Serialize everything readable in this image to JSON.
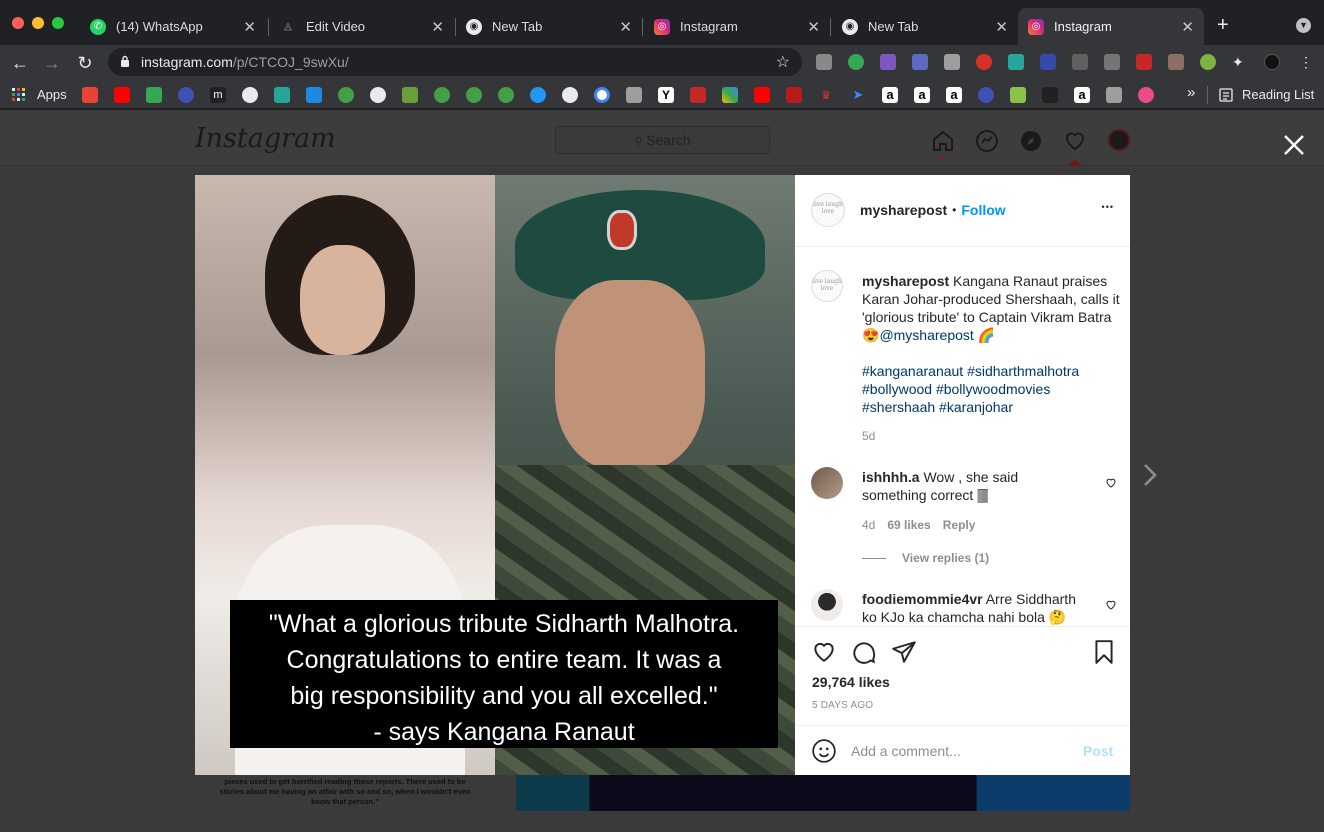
{
  "browser": {
    "tabs": [
      {
        "title": "(14) WhatsApp",
        "icon": "whatsapp-icon",
        "color": "#25d366"
      },
      {
        "title": "Edit Video",
        "icon": "edit-video-icon",
        "color": "#5f6368"
      },
      {
        "title": "New Tab",
        "icon": "chrome-icon",
        "color": "#e8eaed"
      },
      {
        "title": "Instagram",
        "icon": "instagram-icon",
        "color": "#e1306c"
      },
      {
        "title": "New Tab",
        "icon": "chrome-icon",
        "color": "#e8eaed"
      },
      {
        "title": "Instagram",
        "icon": "instagram-icon",
        "color": "#e1306c"
      }
    ],
    "url_host": "instagram.com",
    "url_path": "/p/CTCOJ_9swXu/",
    "bookmarks": {
      "apps_label": "Apps",
      "reading_list_label": "Reading List",
      "overflow_label": "»"
    }
  },
  "instagram": {
    "logo": "Instagram",
    "search_placeholder": "Search",
    "accent": "#0095f6"
  },
  "post": {
    "image_caption_lines": [
      "\"What a glorious tribute Sidharth Malhotra.",
      "Congratulations to entire team. It was a",
      "big responsibility and you all excelled.\"",
      "- says Kangana Ranaut"
    ],
    "below_image_text": [
      "pieces used to get horrified reading those reports. There used to be",
      "stories about me having an affair with so and so, when I wouldn't even",
      "know that person.\""
    ],
    "author": "mysharepost",
    "follow_separator": "•",
    "follow_label": "Follow",
    "more_label": "•••",
    "avatar_text": "live laugh love",
    "caption_text": "Kangana Ranaut praises Karan Johar-produced Shershaah, calls it 'glorious tribute' to Captain Vikram Batra 😍",
    "caption_mention": "@mysharepost",
    "caption_emoji": "🌈",
    "hashtags_line1": "#kanganaranaut #sidharthmalhotra",
    "hashtags_line2": "#bollywood #bollywoodmovies",
    "hashtags_line3": "#shershaah #karanjohar",
    "caption_age": "5d",
    "comments": [
      {
        "user": "ishhhh.a",
        "text": "Wow , she said something correct 🀫",
        "age": "4d",
        "likes": "69 likes",
        "reply": "Reply",
        "view_replies": "View replies (1)"
      },
      {
        "user": "foodiemommie4vr",
        "text": "Arre Siddharth ko KJo ka chamcha nahi bola 🤔"
      }
    ],
    "likes": "29,764 likes",
    "posted": "5 DAYS AGO",
    "add_comment_placeholder": "Add a comment...",
    "post_label": "Post"
  }
}
